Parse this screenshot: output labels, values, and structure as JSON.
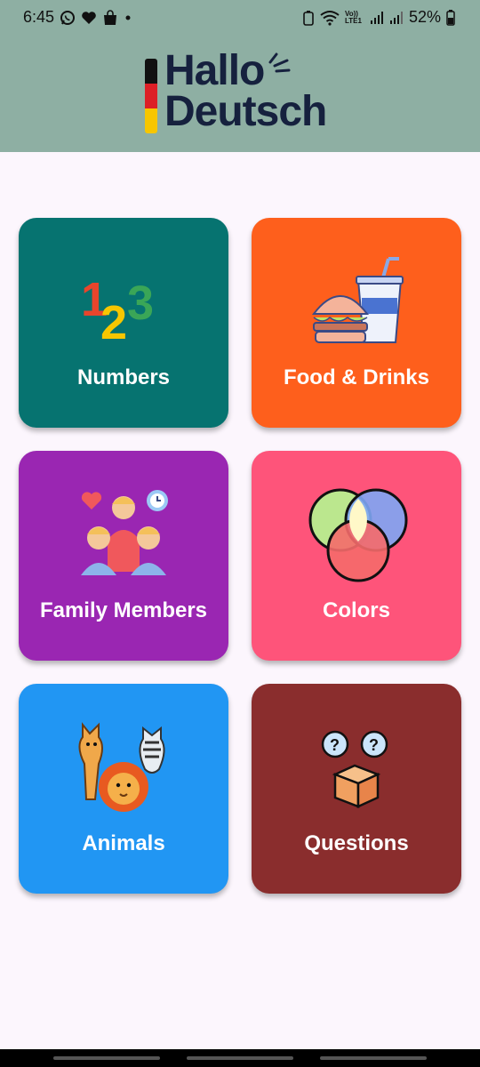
{
  "status": {
    "time": "6:45",
    "battery": "52%",
    "network_label": "Vo)) LTE1"
  },
  "header": {
    "logo_line1": "Hallo",
    "logo_line2": "Deutsch",
    "flag_colors": [
      "#111111",
      "#dd1f26",
      "#f7c600"
    ]
  },
  "categories": [
    {
      "label": "Numbers",
      "color": "#067370",
      "icon": "numbers-123-icon"
    },
    {
      "label": "Food & Drinks",
      "color": "#fe5f1c",
      "icon": "burger-drink-icon"
    },
    {
      "label": "Family Members",
      "color": "#9a26b2",
      "icon": "family-icon"
    },
    {
      "label": "Colors",
      "color": "#fe547a",
      "icon": "venn-colors-icon"
    },
    {
      "label": "Animals",
      "color": "#2196f3",
      "icon": "animals-icon"
    },
    {
      "label": "Questions",
      "color": "#8a2d2d",
      "icon": "question-box-icon"
    }
  ]
}
